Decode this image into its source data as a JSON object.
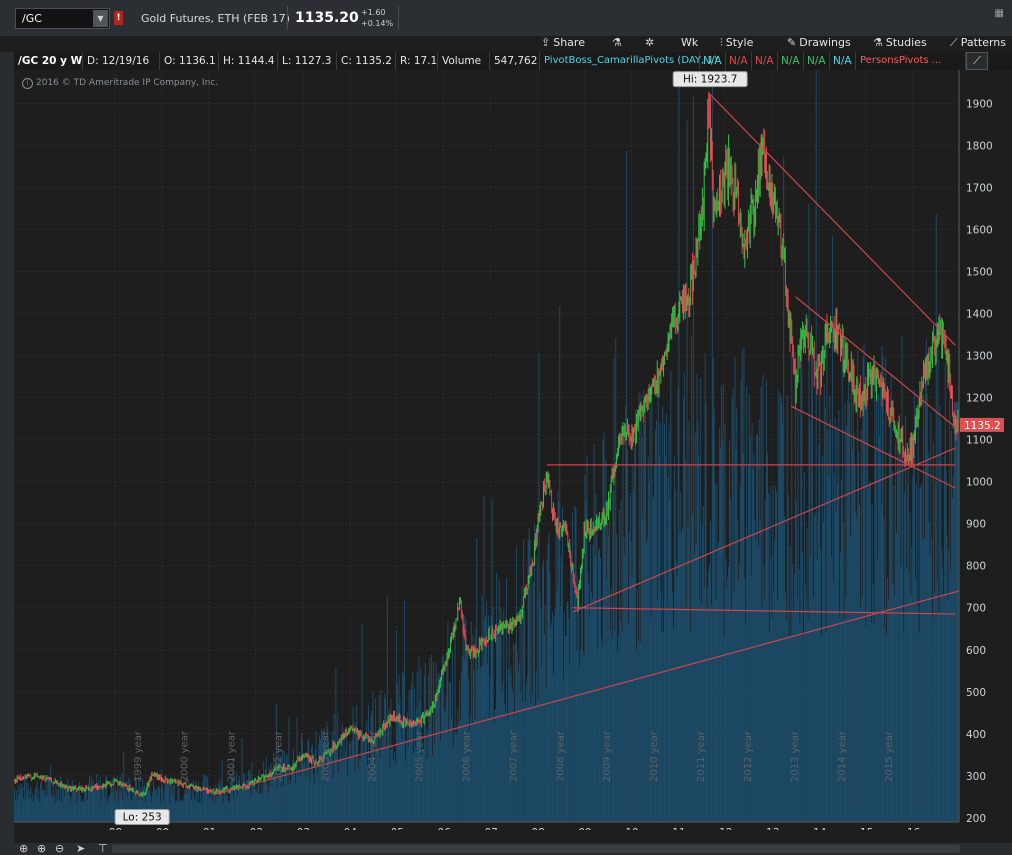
{
  "symbol_bar": {
    "symbol": "/GC",
    "description": "Gold Futures, ETH (FEB 17)",
    "last_price": "1135.20",
    "net_change": "+1.60",
    "pct_change": "+0.14%"
  },
  "toolbar": {
    "share": "Share",
    "wk": "Wk",
    "style": "Style",
    "drawings": "Drawings",
    "studies": "Studies",
    "patterns": "Patterns"
  },
  "study_bar": {
    "title": "/GC 20 y W",
    "date": "D: 12/19/16",
    "open": "O: 1136.1",
    "high": "H: 1144.4",
    "low": "L: 1127.3",
    "close": "C: 1135.2",
    "range": "R: 17.1",
    "volume_label": "Volume",
    "volume_value": "547,762",
    "study_name": "PivotBoss_CamarillaPivots (DAY, 1)",
    "na1": "N/A",
    "na2": "N/A",
    "na3": "N/A",
    "na4": "N/A",
    "na5": "N/A",
    "na6": "N/A",
    "persons": "PersonsPivots ..."
  },
  "copyright": "2016 © TD Ameritrade IP Company, Inc.",
  "chart_data": {
    "type": "candlestick",
    "title": "/GC 20 y W",
    "ylim": [
      190,
      1980
    ],
    "price_ticks": [
      200,
      300,
      400,
      500,
      600,
      700,
      800,
      900,
      1000,
      1100,
      1200,
      1300,
      1400,
      1500,
      1600,
      1700,
      1800,
      1900
    ],
    "x_range_years": [
      1996.85,
      2016.98
    ],
    "x_tick_labels": [
      "99",
      "00",
      "01",
      "02",
      "03",
      "04",
      "05",
      "06",
      "07",
      "08",
      "09",
      "10",
      "11",
      "12",
      "13",
      "14",
      "15",
      "16"
    ],
    "x_tick_years": [
      1999,
      2000,
      2001,
      2002,
      2003,
      2004,
      2005,
      2006,
      2007,
      2008,
      2009,
      2010,
      2011,
      2012,
      2013,
      2014,
      2015,
      2016
    ],
    "year_watermarks": [
      "1999 year",
      "2000 year",
      "2001 year",
      "2002 year",
      "2003 year",
      "2004 year",
      "2005 year",
      "2006 year",
      "2007 year",
      "2008 year",
      "2009 year",
      "2010 year",
      "2011 year",
      "2012 year",
      "2013 year",
      "2014 year",
      "2015 year"
    ],
    "price_path": [
      [
        1996.85,
        290
      ],
      [
        1997.3,
        300
      ],
      [
        1997.6,
        290
      ],
      [
        1998.0,
        270
      ],
      [
        1998.3,
        268
      ],
      [
        1998.7,
        275
      ],
      [
        1999.0,
        285
      ],
      [
        1999.4,
        265
      ],
      [
        1999.6,
        253
      ],
      [
        1999.8,
        305
      ],
      [
        2000.0,
        290
      ],
      [
        2000.4,
        280
      ],
      [
        2000.8,
        270
      ],
      [
        2001.1,
        262
      ],
      [
        2001.4,
        268
      ],
      [
        2001.8,
        275
      ],
      [
        2002.2,
        298
      ],
      [
        2002.5,
        318
      ],
      [
        2002.8,
        320
      ],
      [
        2003.0,
        350
      ],
      [
        2003.3,
        330
      ],
      [
        2003.7,
        375
      ],
      [
        2004.0,
        410
      ],
      [
        2004.3,
        395
      ],
      [
        2004.5,
        385
      ],
      [
        2004.9,
        440
      ],
      [
        2005.2,
        425
      ],
      [
        2005.5,
        430
      ],
      [
        2005.8,
        470
      ],
      [
        2006.0,
        550
      ],
      [
        2006.35,
        715
      ],
      [
        2006.5,
        590
      ],
      [
        2006.7,
        600
      ],
      [
        2007.0,
        640
      ],
      [
        2007.4,
        660
      ],
      [
        2007.6,
        670
      ],
      [
        2007.9,
        800
      ],
      [
        2008.0,
        900
      ],
      [
        2008.2,
        1010
      ],
      [
        2008.4,
        880
      ],
      [
        2008.6,
        900
      ],
      [
        2008.8,
        740
      ],
      [
        2008.85,
        705
      ],
      [
        2009.0,
        880
      ],
      [
        2009.3,
        900
      ],
      [
        2009.5,
        940
      ],
      [
        2009.8,
        1130
      ],
      [
        2010.0,
        1100
      ],
      [
        2010.3,
        1200
      ],
      [
        2010.6,
        1250
      ],
      [
        2010.9,
        1390
      ],
      [
        2011.2,
        1420
      ],
      [
        2011.5,
        1620
      ],
      [
        2011.65,
        1900
      ],
      [
        2011.75,
        1650
      ],
      [
        2011.9,
        1700
      ],
      [
        2012.1,
        1750
      ],
      [
        2012.4,
        1560
      ],
      [
        2012.6,
        1650
      ],
      [
        2012.8,
        1780
      ],
      [
        2013.0,
        1680
      ],
      [
        2013.2,
        1580
      ],
      [
        2013.35,
        1400
      ],
      [
        2013.5,
        1230
      ],
      [
        2013.7,
        1380
      ],
      [
        2014.0,
        1240
      ],
      [
        2014.2,
        1380
      ],
      [
        2014.5,
        1320
      ],
      [
        2014.9,
        1180
      ],
      [
        2015.1,
        1260
      ],
      [
        2015.5,
        1170
      ],
      [
        2015.9,
        1060
      ],
      [
        2016.0,
        1090
      ],
      [
        2016.2,
        1240
      ],
      [
        2016.55,
        1370
      ],
      [
        2016.7,
        1320
      ],
      [
        2016.85,
        1170
      ],
      [
        2016.95,
        1135
      ]
    ],
    "annotations": [
      {
        "text": "Hi: 1923.7",
        "year": 2011.68,
        "price": 1923.7
      },
      {
        "text": "Lo: 253",
        "year": 1999.58,
        "price": 253
      }
    ],
    "current_price_label": "1135.2",
    "trendlines": [
      {
        "from": [
          2011.65,
          1925
        ],
        "to": [
          2016.9,
          1325
        ]
      },
      {
        "from": [
          2013.5,
          1440
        ],
        "to": [
          2016.9,
          1130
        ]
      },
      {
        "from": [
          2013.4,
          1180
        ],
        "to": [
          2016.9,
          985
        ]
      },
      {
        "from": [
          2008.2,
          1040
        ],
        "to": [
          2016.9,
          1040
        ]
      },
      {
        "from": [
          2008.75,
          700
        ],
        "to": [
          2016.9,
          685
        ]
      },
      {
        "from": [
          2008.75,
          690
        ],
        "to": [
          2016.9,
          1080
        ]
      },
      {
        "from": [
          2001.1,
          255
        ],
        "to": [
          2016.98,
          740
        ]
      }
    ],
    "volume_scale_max": 1000,
    "colors": {
      "up": "#2fc443",
      "down": "#e0474f",
      "trendline": "#c9474d",
      "volume": "#1d4a66",
      "background": "#1e1e1e",
      "grid": "#3a3a3a",
      "label_bg": "#e05050"
    }
  }
}
